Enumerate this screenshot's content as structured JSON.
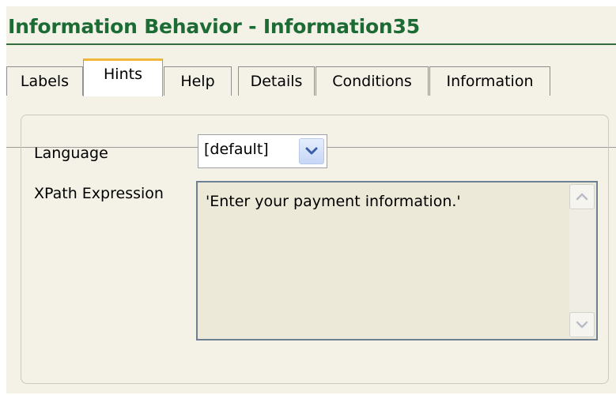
{
  "header": {
    "title": "Information Behavior - Information35"
  },
  "tabs": [
    {
      "label": "Labels"
    },
    {
      "label": "Hints"
    },
    {
      "label": "Help"
    },
    {
      "label": "Details"
    },
    {
      "label": "Conditions"
    },
    {
      "label": "Information"
    }
  ],
  "active_tab": "Hints",
  "form": {
    "language_label": "Language",
    "language_value": "[default]",
    "xpath_label": "XPath Expression",
    "xpath_value": "'Enter your payment information.'"
  },
  "icons": {
    "dropdown": "chevron-down-icon",
    "scroll_up": "scroll-up-icon",
    "scroll_down": "scroll-down-icon"
  },
  "colors": {
    "title": "#1d6b34",
    "background": "#f4f1e6",
    "active_tab_accent": "#f0b83a"
  }
}
